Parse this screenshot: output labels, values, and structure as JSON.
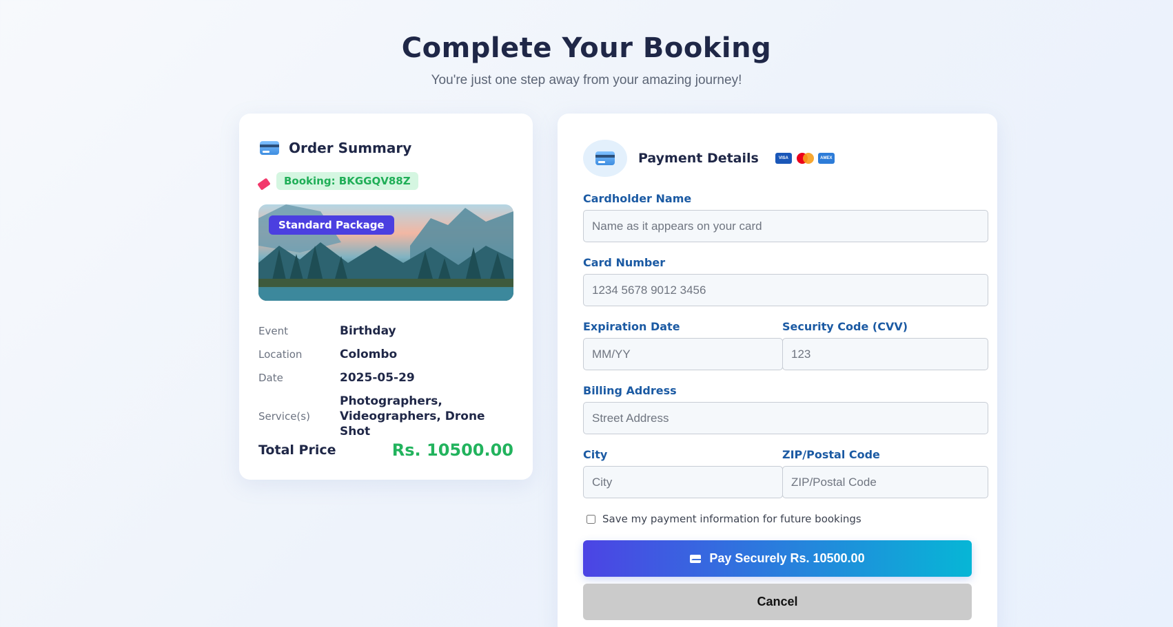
{
  "header": {
    "title": "Complete Your Booking",
    "subtitle": "You're just one step away from your amazing journey!"
  },
  "summary": {
    "title": "Order Summary",
    "booking_label": "Booking: BKGGQV88Z",
    "package_badge": "Standard Package",
    "details": [
      {
        "label": "Event",
        "value": "Birthday"
      },
      {
        "label": "Location",
        "value": "Colombo"
      },
      {
        "label": "Date",
        "value": "2025-05-29"
      },
      {
        "label": "Service(s)",
        "value": "Photographers, Videographers, Drone Shot"
      }
    ],
    "total_label": "Total Price",
    "total_value": "Rs. 10500.00"
  },
  "payment": {
    "title": "Payment Details",
    "brands": [
      "VISA",
      "AMEX"
    ],
    "fields": {
      "cardholder": {
        "label": "Cardholder Name",
        "placeholder": "Name as it appears on your card"
      },
      "card_number": {
        "label": "Card Number",
        "placeholder": "1234 5678 9012 3456"
      },
      "expiry": {
        "label": "Expiration Date",
        "placeholder": "MM/YY"
      },
      "cvv": {
        "label": "Security Code (CVV)",
        "placeholder": "123"
      },
      "address": {
        "label": "Billing Address",
        "placeholder": "Street Address"
      },
      "city": {
        "label": "City",
        "placeholder": "City"
      },
      "zip": {
        "label": "ZIP/Postal Code",
        "placeholder": "ZIP/Postal Code"
      }
    },
    "save_label": "Save my payment information for future bookings",
    "pay_label": "Pay Securely Rs. 10500.00",
    "cancel_label": "Cancel"
  },
  "colors": {
    "accent_green": "#22b35d",
    "label_blue": "#1b5aa3",
    "gradient_start": "#4c44e4",
    "gradient_end": "#07b6d6"
  }
}
